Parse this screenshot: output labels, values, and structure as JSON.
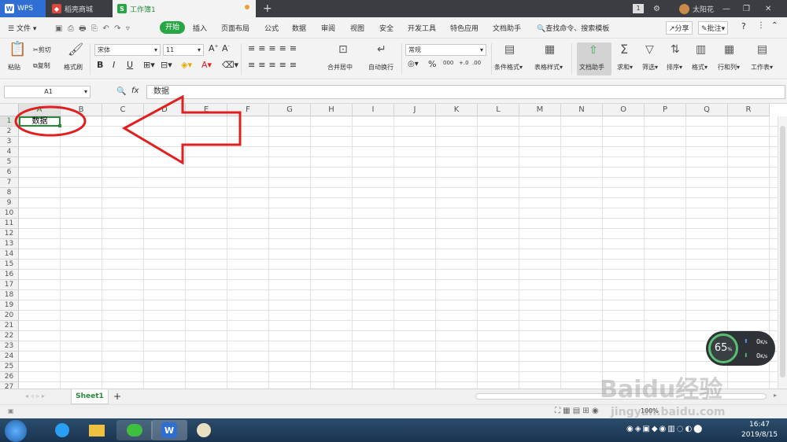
{
  "titlebar": {
    "wps_label": "WPS",
    "tab_store": "稻壳商城",
    "tab_book": "工作簿1",
    "badge": "1",
    "user_name": "太阳花",
    "plus": "+"
  },
  "menubar": {
    "file": "文件",
    "items": [
      "开始",
      "插入",
      "页面布局",
      "公式",
      "数据",
      "审阅",
      "视图",
      "安全",
      "开发工具",
      "特色应用",
      "文档助手"
    ],
    "search": "查找命令、搜索模板",
    "share": "分享",
    "comment": "批注",
    "help": "?"
  },
  "ribbon": {
    "paste": "粘贴",
    "cut": "剪切",
    "copy": "复制",
    "format_painter": "格式刷",
    "font_name": "宋体",
    "font_size": "11",
    "bold": "B",
    "italic": "I",
    "underline": "U",
    "merge": "合并居中",
    "wrap": "自动换行",
    "number_format": "常规",
    "percent": "%",
    "thousands": "000",
    "cond_format": "条件格式",
    "table_style": "表格样式",
    "doc_assistant": "文档助手",
    "sum": "求和",
    "filter": "筛选",
    "sort": "排序",
    "format": "格式",
    "rows_cols": "行和列",
    "worksheet": "工作表"
  },
  "formula": {
    "cell_ref": "A1",
    "fx": "fx",
    "content": "数据"
  },
  "grid": {
    "columns": [
      "A",
      "B",
      "C",
      "D",
      "E",
      "F",
      "G",
      "H",
      "I",
      "J",
      "K",
      "L",
      "M",
      "N",
      "O",
      "P",
      "Q",
      "R"
    ],
    "rows": [
      "1",
      "2",
      "3",
      "4",
      "5",
      "6",
      "7",
      "8",
      "9",
      "10",
      "11",
      "12",
      "13",
      "14",
      "15",
      "16",
      "17",
      "18",
      "19",
      "20",
      "21",
      "22",
      "23",
      "24",
      "25",
      "26",
      "27"
    ],
    "a1_value": "数据"
  },
  "sheets": {
    "active": "Sheet1",
    "add": "+"
  },
  "status": {
    "zoom": "100%"
  },
  "netmon": {
    "percent": "65",
    "unit": "%",
    "up": "0",
    "down": "0",
    "rate_unit": "K/s"
  },
  "taskbar": {
    "time": "16:47",
    "date": "2019/8/15"
  },
  "watermark": {
    "text": "Baidu经验",
    "url": "jingyan.baidu.com"
  },
  "colors": {
    "accent_green": "#27a644",
    "annotation_red": "#e02020",
    "titlebar": "#3a3d42"
  }
}
